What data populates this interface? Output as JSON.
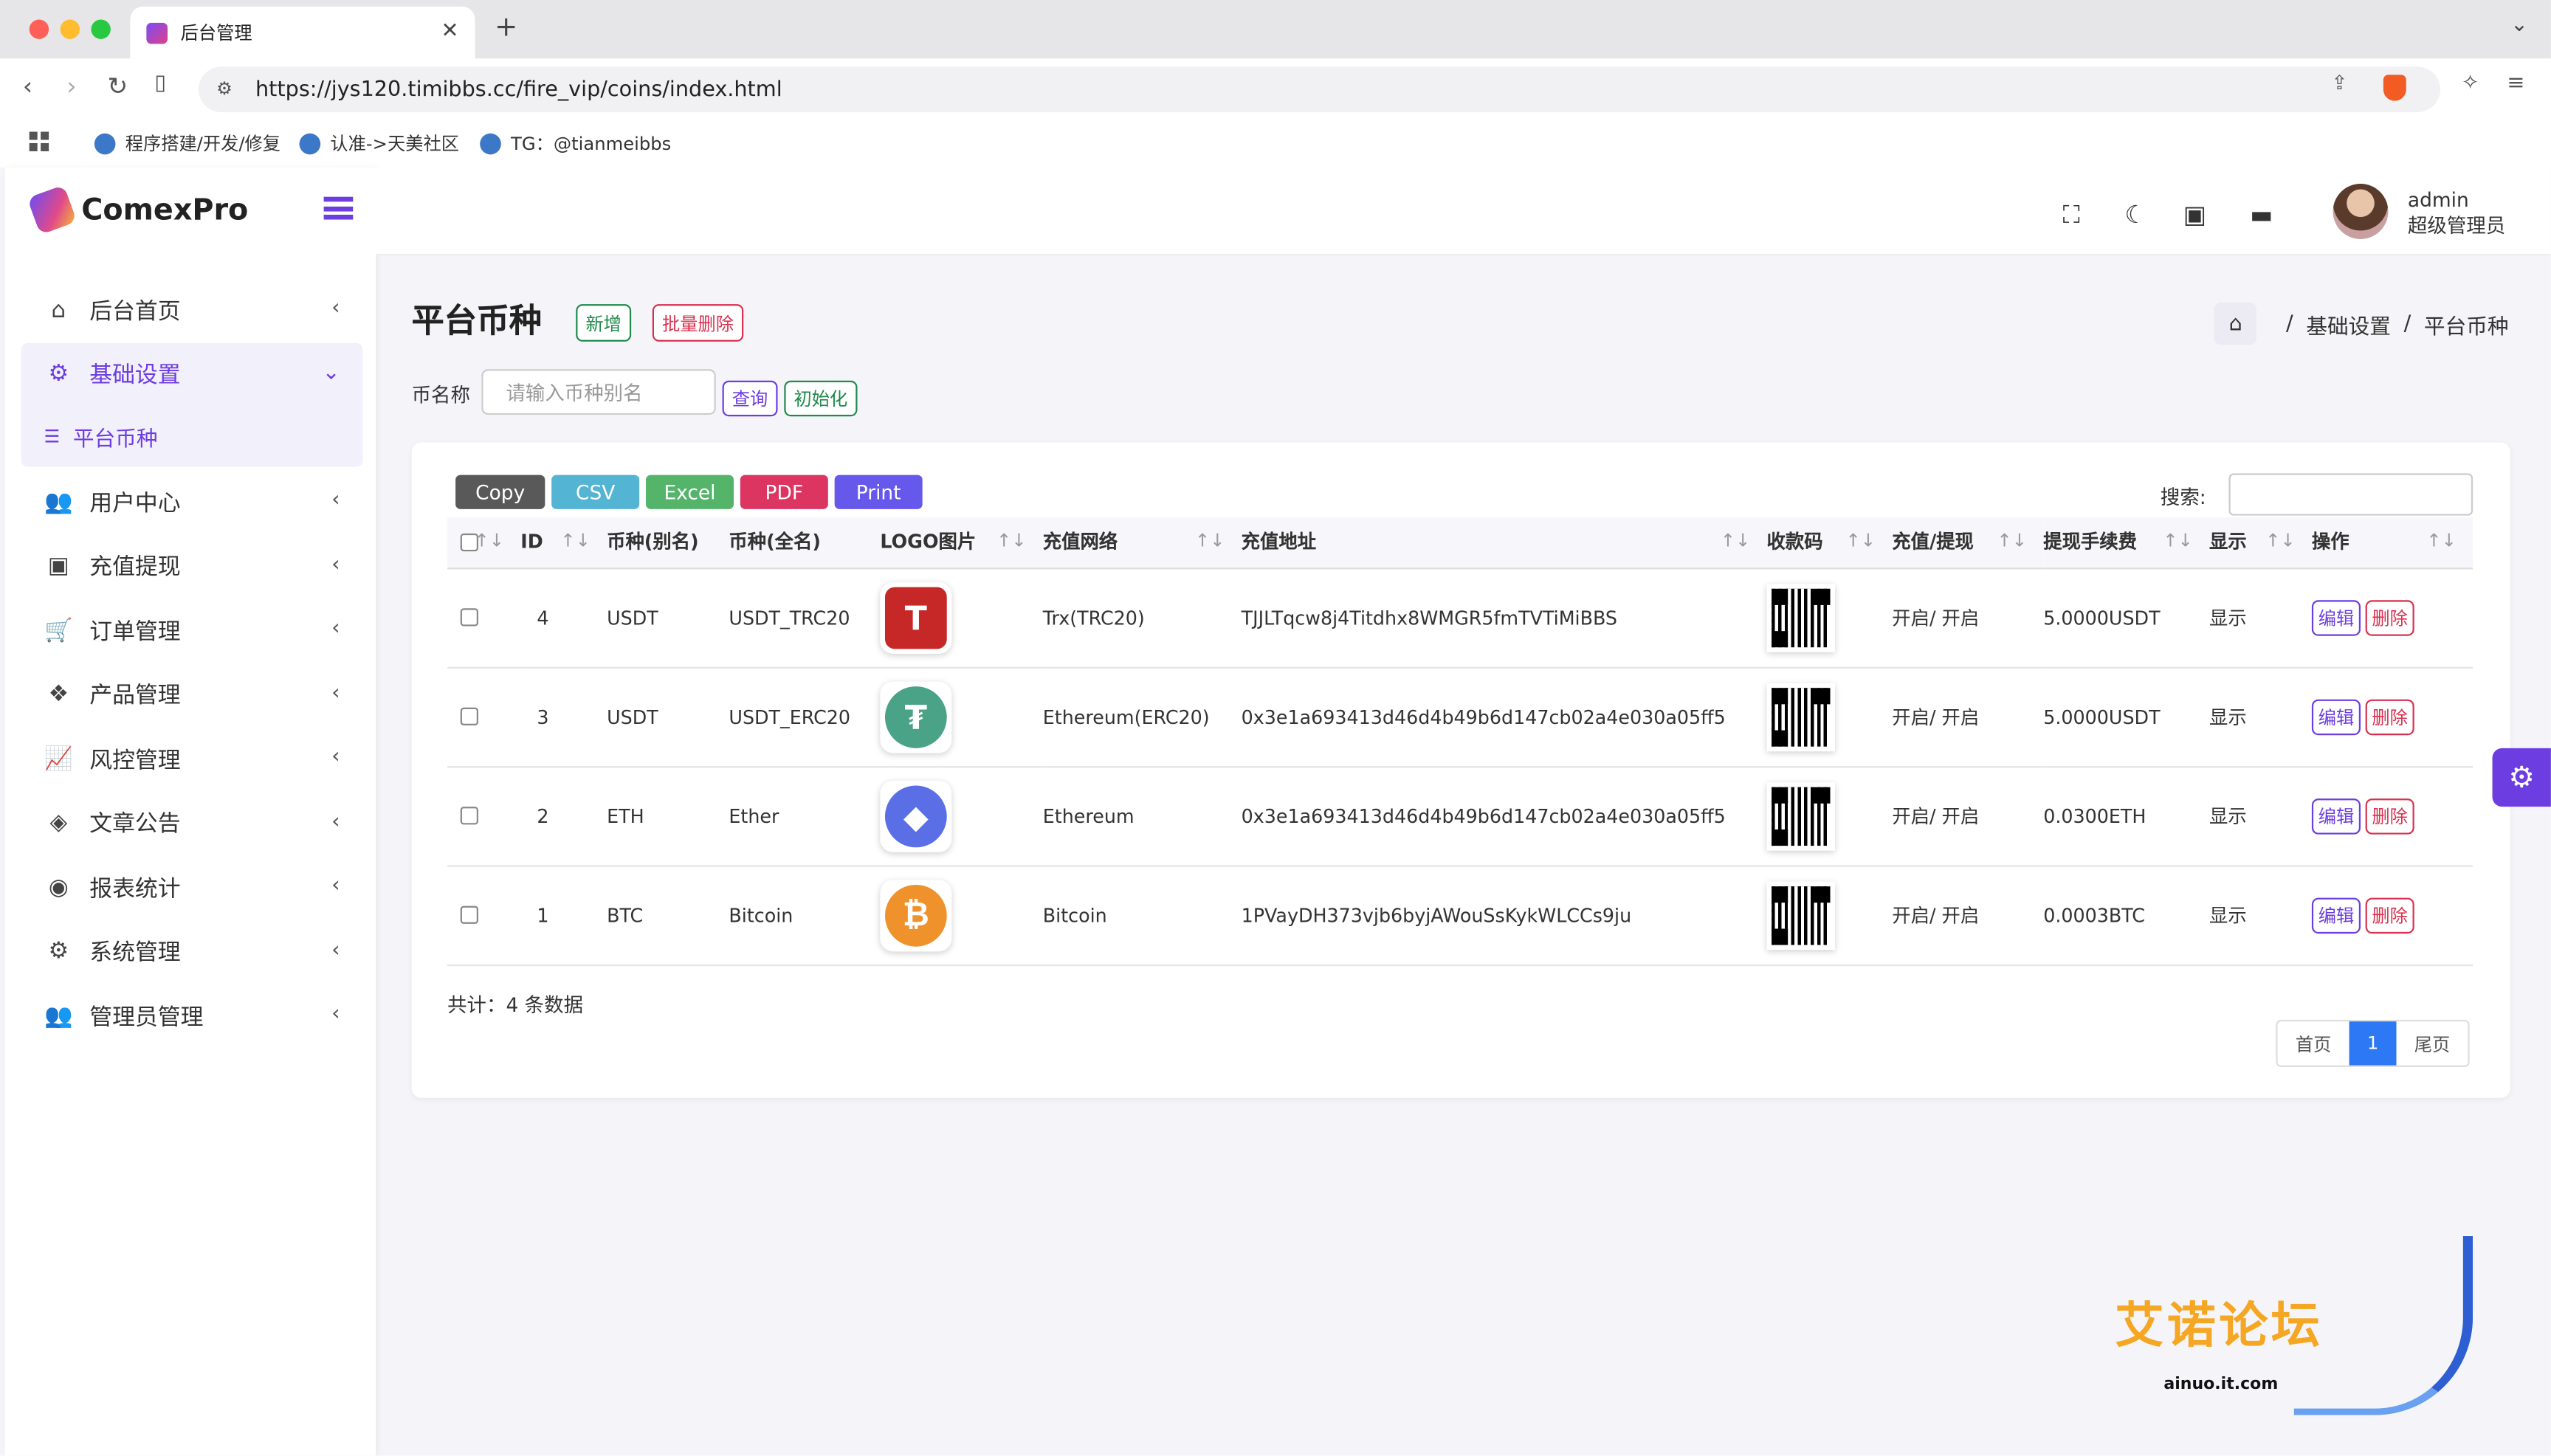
{
  "browser": {
    "tab_title": "后台管理",
    "url": "https://jys120.timibbs.cc/fire_vip/coins/index.html",
    "bookmarks": [
      "程序搭建/开发/修复",
      "认准->天美社区",
      "TG：@tianmeibbs"
    ]
  },
  "brand": {
    "name": "ComexPro"
  },
  "sidebar": {
    "items": [
      {
        "label": "后台首页",
        "icon": "home-icon"
      },
      {
        "label": "基础设置",
        "icon": "gears-icon",
        "active": true,
        "sub": "平台币种"
      },
      {
        "label": "用户中心",
        "icon": "users-icon"
      },
      {
        "label": "充值提现",
        "icon": "money-icon"
      },
      {
        "label": "订单管理",
        "icon": "cart-icon"
      },
      {
        "label": "产品管理",
        "icon": "cubes-icon"
      },
      {
        "label": "风控管理",
        "icon": "chart-line-icon"
      },
      {
        "label": "文章公告",
        "icon": "layers-icon"
      },
      {
        "label": "报表统计",
        "icon": "coins-icon"
      },
      {
        "label": "系统管理",
        "icon": "gear-icon"
      },
      {
        "label": "管理员管理",
        "icon": "admins-icon"
      }
    ]
  },
  "user": {
    "name": "admin",
    "role": "超级管理员"
  },
  "page": {
    "title": "平台币种",
    "add": "新增",
    "batch_delete": "批量删除",
    "breadcrumb": [
      "基础设置",
      "平台币种"
    ],
    "filter_label": "币名称",
    "filter_placeholder": "请输入币种别名",
    "query": "查询",
    "init": "初始化"
  },
  "export": {
    "copy": "Copy",
    "csv": "CSV",
    "excel": "Excel",
    "pdf": "PDF",
    "print": "Print",
    "search_label": "搜索:"
  },
  "table": {
    "headers": [
      "ID",
      "币种(别名)",
      "币种(全名)",
      "LOGO图片",
      "充值网络",
      "充值地址",
      "收款码",
      "充值/提现",
      "提现手续费",
      "显示",
      "操作"
    ],
    "rows": [
      {
        "id": "4",
        "alias": "USDT",
        "full": "USDT_TRC20",
        "logo": "tron-usdt",
        "network": "Trx(TRC20)",
        "address": "TJJLTqcw8j4Titdhx8WMGR5fmTVTiMiBBS",
        "status": "开启/ 开启",
        "fee": "5.0000USDT",
        "show": "显示"
      },
      {
        "id": "3",
        "alias": "USDT",
        "full": "USDT_ERC20",
        "logo": "tether",
        "network": "Ethereum(ERC20)",
        "address": "0x3e1a693413d46d4b49b6d147cb02a4e030a05ff5",
        "status": "开启/ 开启",
        "fee": "5.0000USDT",
        "show": "显示"
      },
      {
        "id": "2",
        "alias": "ETH",
        "full": "Ether",
        "logo": "ethereum",
        "network": "Ethereum",
        "address": "0x3e1a693413d46d4b49b6d147cb02a4e030a05ff5",
        "status": "开启/ 开启",
        "fee": "0.0300ETH",
        "show": "显示"
      },
      {
        "id": "1",
        "alias": "BTC",
        "full": "Bitcoin",
        "logo": "bitcoin",
        "network": "Bitcoin",
        "address": "1PVayDH373vjb6byjAWouSsKykWLCCs9ju",
        "status": "开启/ 开启",
        "fee": "0.0003BTC",
        "show": "显示"
      }
    ],
    "edit": "编辑",
    "delete": "删除"
  },
  "footer": {
    "total": "共计：4 条数据",
    "first": "首页",
    "current": "1",
    "last": "尾页"
  },
  "watermark": {
    "text": "艾诺论坛",
    "url": "ainuo.it.com"
  }
}
